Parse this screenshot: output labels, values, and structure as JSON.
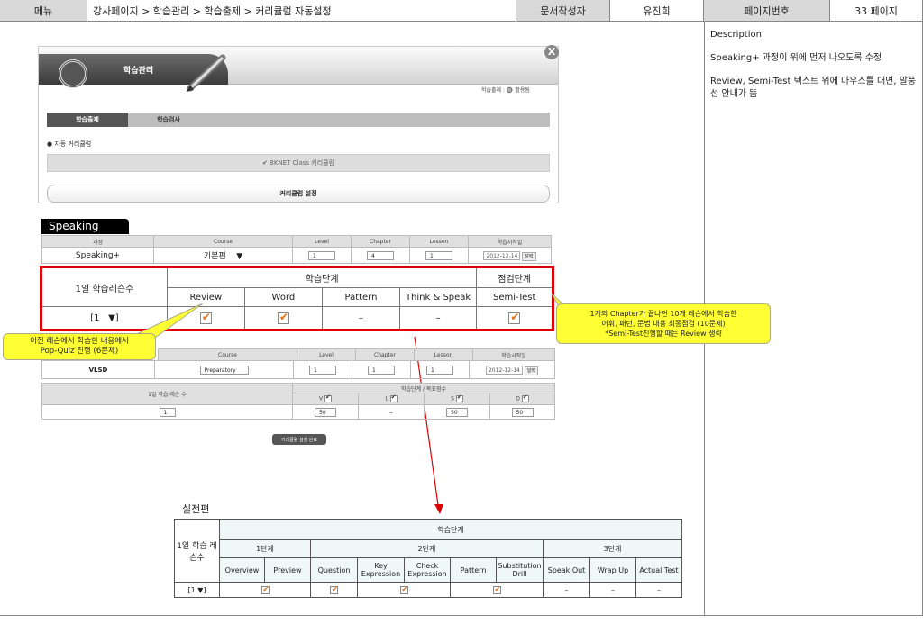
{
  "header": {
    "menu_label": "메뉴",
    "breadcrumb": "강사페이지 > 학습관리 > 학습출제 > 커리큘럼 자동설정",
    "author_label": "문서작성자",
    "author_name": "유진희",
    "page_label": "페이지번호",
    "page_value": "33 페이지"
  },
  "description": {
    "title": "Description",
    "lines": [
      "Speaking+ 과정이 위에 먼저 나오도록 수정",
      "Review, Semi-Test 텍스트 위에 마우스를 대면, 말풍선 안내가 뜸"
    ]
  },
  "popup": {
    "title": "학습관리",
    "close_glyph": "X",
    "legend": "학습출제 : 🔘 활용됨",
    "tabs": [
      "학습출제",
      "학습검사"
    ],
    "section_label": "● 자동 커리큘럼",
    "bknet_label": "✔ BKNET Class 커리큘럼",
    "curriculum_button": "커리큘럼 설정"
  },
  "speaking": {
    "tab_label": "Speaking",
    "headers": [
      "과정",
      "Course",
      "Level",
      "Chapter",
      "Lesson",
      "학습시작일"
    ],
    "row": {
      "course_name": "Speaking+",
      "course_select": "기본편",
      "course_arrow": "▼",
      "level": "1",
      "chapter": "4",
      "lesson": "1",
      "date": "2012-12-14",
      "date_button": "달력"
    }
  },
  "red_table": {
    "daily_label": "1일 학습레슨수",
    "stage_label": "학습단계",
    "check_label": "점검단계",
    "columns": [
      "Review",
      "Word",
      "Pattern",
      "Think & Speak",
      "Semi-Test"
    ],
    "daily_value": "[1",
    "daily_arrow": "▼]",
    "values": [
      "check",
      "check",
      "–",
      "–",
      "check"
    ]
  },
  "callouts": {
    "left": "이전 레슨에서 학습한 내용에서\nPop-Quiz 진행 (6문제)",
    "right": "1개의 Chapter가 끝나면 10개 레슨에서 학습한\n어휘, 패턴, 문법 내용 최종점검 (10문제)\n*Semi-Test진행할 때는 Review 생략"
  },
  "vlsd": {
    "headers": [
      "과정",
      "Course",
      "Level",
      "Chapter",
      "Lesson",
      "학습시작일"
    ],
    "row": {
      "course_name": "VLSD",
      "course_select": "Preparatory",
      "level": "1",
      "chapter": "1",
      "lesson": "1",
      "date": "2012-12-14",
      "date_button": "달력"
    },
    "daily_label": "1일 학습 레슨 수",
    "goal_label": "학습단계 / 목표점수",
    "goal_columns": [
      "V",
      "L",
      "S",
      "D"
    ],
    "daily_value": "1",
    "goal_values": [
      "50",
      "–",
      "50",
      "50"
    ]
  },
  "done_button": "커리큘럼 설정 완료",
  "practical": {
    "title": "실전편",
    "daily_label": "1일 학습 레슨수",
    "stage_label": "학습단계",
    "groups": [
      "1단계",
      "2단계",
      "3단계"
    ],
    "columns": [
      "Overview",
      "Preview",
      "Question",
      "Key Expression",
      "Check Expression",
      "Pattern",
      "Substitution Drill",
      "Speak Out",
      "Wrap Up",
      "Actual Test"
    ],
    "daily_value": "[1",
    "daily_arrow": "▼]",
    "dash": "–"
  }
}
